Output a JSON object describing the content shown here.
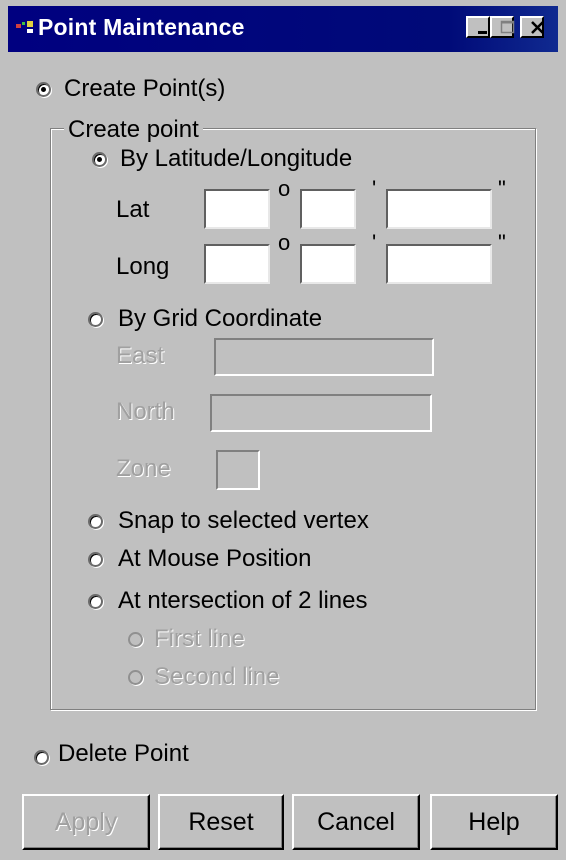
{
  "window": {
    "title": "Point Maintenance",
    "controls": {
      "minimize": "_",
      "maximize": "□",
      "close": "✕"
    }
  },
  "mode": {
    "create_label": "Create Point(s)",
    "create_selected": true,
    "delete_label": "Delete Point",
    "delete_selected": false
  },
  "create_point": {
    "group_label": "Create point",
    "latlong": {
      "option_label": "By Latitude/Longitude",
      "selected": true,
      "lat_label": "Lat",
      "long_label": "Long",
      "degree_symbol": "o",
      "minute_symbol": "'",
      "second_symbol": "\"",
      "lat_values": {
        "deg": "",
        "min": "",
        "sec": ""
      },
      "long_values": {
        "deg": "",
        "min": "",
        "sec": ""
      }
    },
    "grid": {
      "option_label": "By Grid Coordinate",
      "selected": false,
      "east_label": "East",
      "north_label": "North",
      "zone_label": "Zone",
      "east_value": "",
      "north_value": "",
      "zone_value": ""
    },
    "snap_label": "Snap to selected vertex",
    "mouse_label": "At Mouse Position",
    "intersection": {
      "option_label": "At ntersection of 2 lines",
      "first_line_label": "First line",
      "second_line_label": "Second line"
    }
  },
  "buttons": {
    "apply": "Apply",
    "reset": "Reset",
    "cancel": "Cancel",
    "help": "Help"
  }
}
